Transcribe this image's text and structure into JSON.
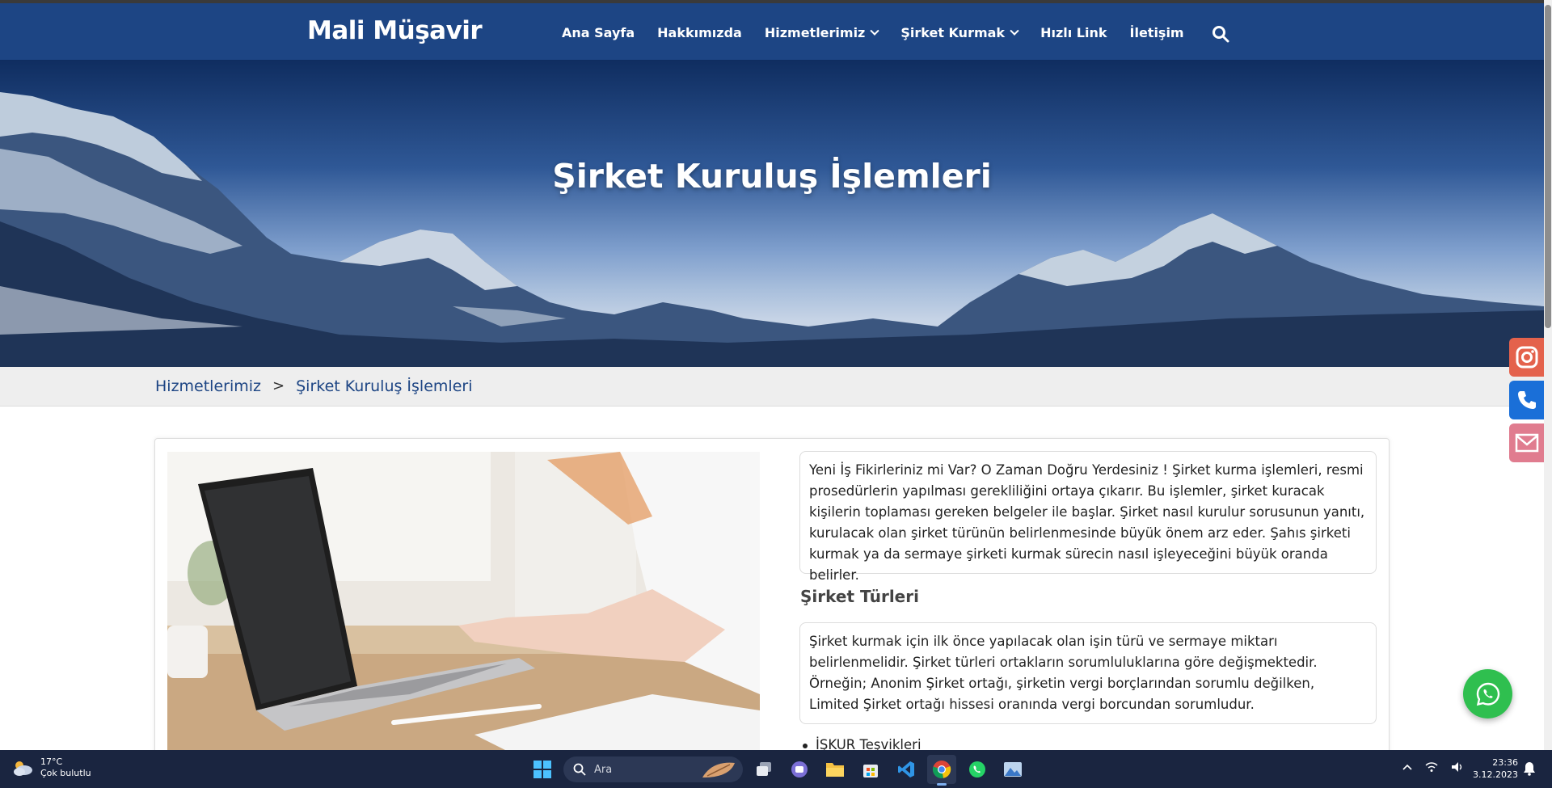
{
  "header": {
    "brand": "Mali Müşavir",
    "nav": [
      {
        "label": "Ana Sayfa",
        "dropdown": false
      },
      {
        "label": "Hakkımızda",
        "dropdown": false
      },
      {
        "label": "Hizmetlerimiz",
        "dropdown": true
      },
      {
        "label": "Şirket Kurmak",
        "dropdown": true
      },
      {
        "label": "Hızlı Link",
        "dropdown": false
      },
      {
        "label": "İletişim",
        "dropdown": false
      }
    ],
    "search_icon": "search-icon"
  },
  "hero": {
    "title": "Şirket Kuruluş İşlemleri"
  },
  "breadcrumb": {
    "items": [
      "Hizmetlerimiz",
      "Şirket Kuruluş İşlemleri"
    ],
    "separator": ">"
  },
  "content": {
    "intro": "Yeni İş Fikirleriniz mi Var? O Zaman Doğru Yerdesiniz ! Şirket kurma işlemleri, resmi prosedürlerin yapılması gerekliliğini ortaya çıkarır. Bu işlemler, şirket kuracak kişilerin toplaması gereken belgeler ile başlar. Şirket nasıl kurulur sorusunun yanıtı, kurulacak olan şirket türünün belirlenmesinde büyük önem arz eder. Şahıs şirketi kurmak ya da sermaye şirketi kurmak sürecin nasıl işleyeceğini büyük oranda belirler.",
    "section_title": "Şirket Türleri",
    "section_text": "Şirket kurmak için ilk önce yapılacak olan işin türü ve sermaye miktarı belirlenmelidir. Şirket türleri ortakların sorumluluklarına göre değişmektedir. Örneğin; Anonim Şirket ortağı, şirketin vergi borçlarından sorumlu değilken, Limited Şirket ortağı hissesi oranında vergi borcundan sorumludur.",
    "list_items": [
      "İŞKUR Teşvikleri"
    ]
  },
  "side_buttons": [
    "instagram-icon",
    "phone-icon",
    "mail-icon"
  ],
  "whatsapp": "whatsapp-icon",
  "taskbar": {
    "weather_temp": "17°C",
    "weather_desc": "Çok bulutlu",
    "search_placeholder": "Ara",
    "apps": [
      "start-icon",
      "task-view-icon",
      "teams-icon",
      "file-explorer-icon",
      "store-icon",
      "vscode-icon",
      "chrome-icon",
      "whatsapp-icon",
      "photos-icon"
    ],
    "time": "23:36",
    "date": "3.12.2023"
  },
  "colors": {
    "nav_bg": "#1d4584",
    "breadcrumb_link": "#1d4584",
    "whatsapp": "#2fbf4f",
    "instagram": "#e4624c",
    "phone": "#1a6fd8",
    "mail": "#e07c8f",
    "taskbar": "#1a2540"
  }
}
